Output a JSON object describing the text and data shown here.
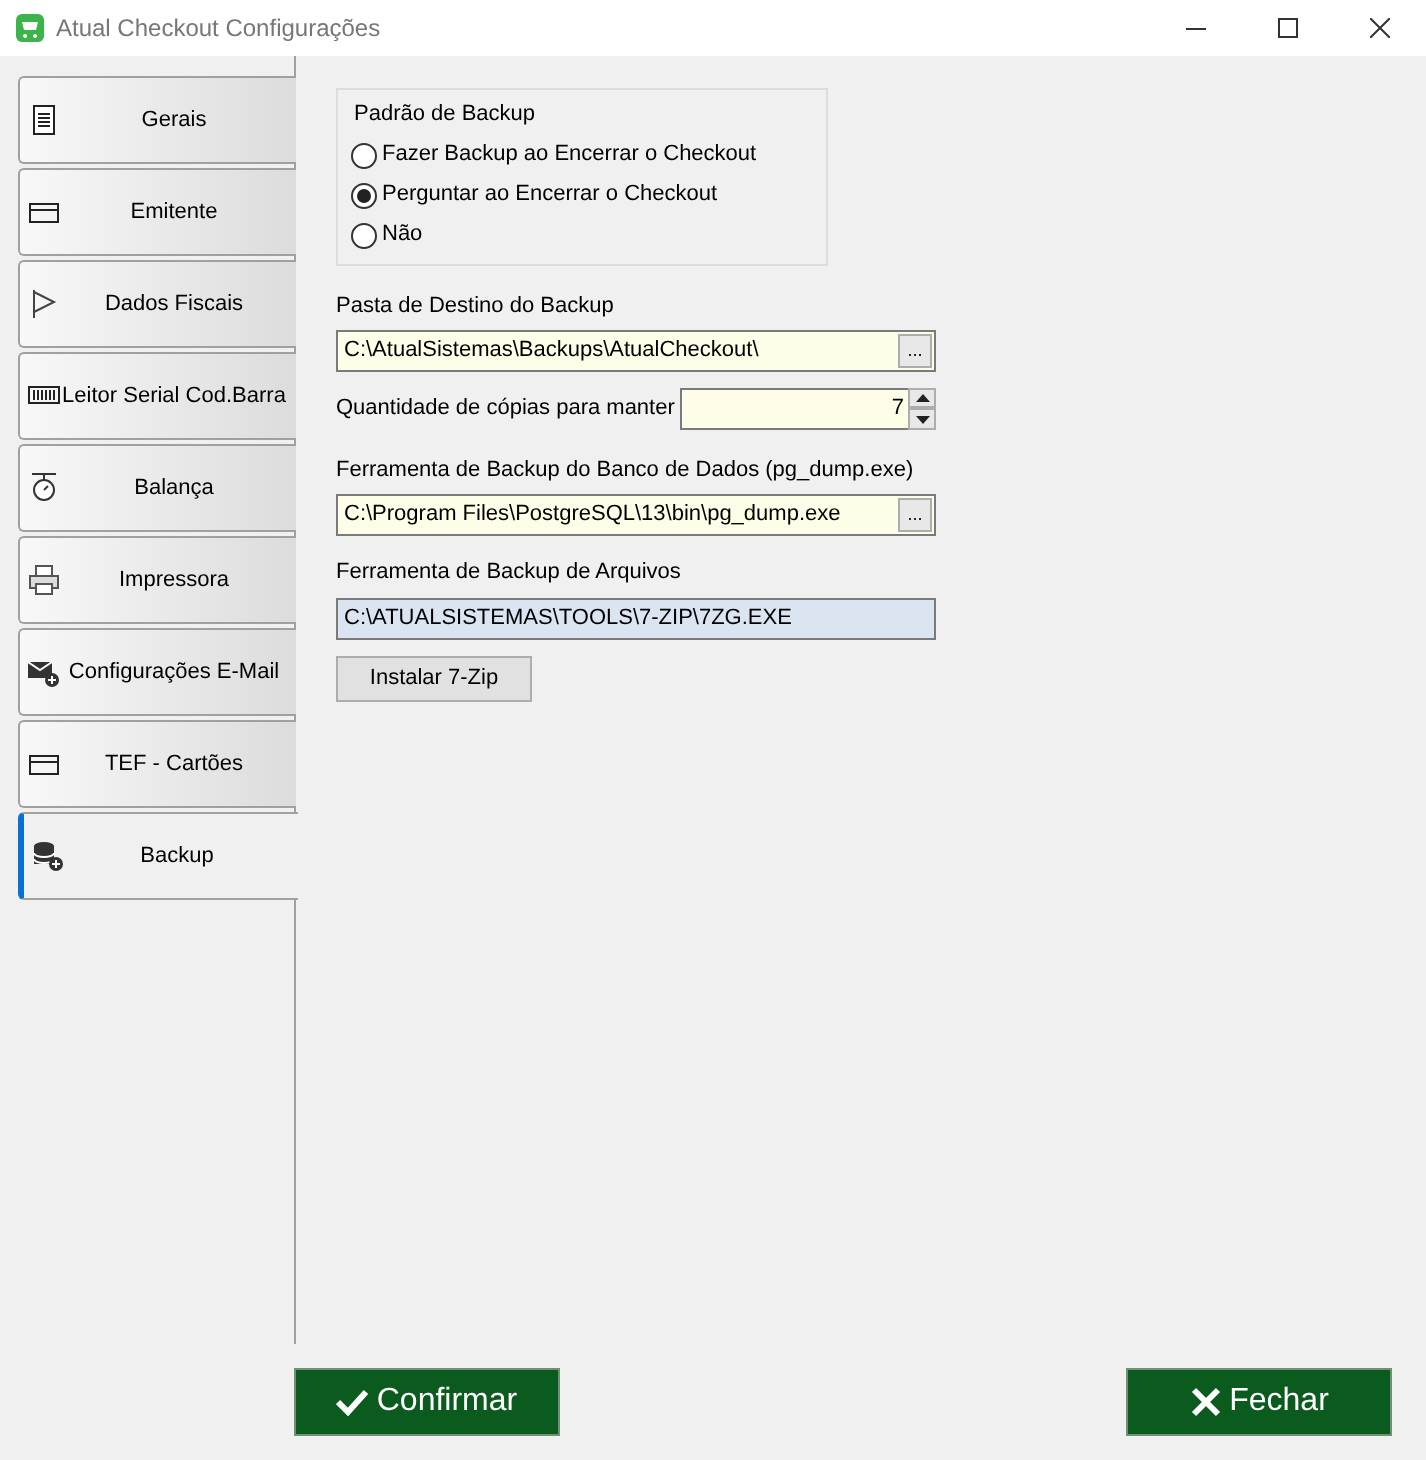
{
  "window": {
    "title": "Atual Checkout Configurações"
  },
  "tabs": [
    {
      "label": "Gerais",
      "selected": false
    },
    {
      "label": "Emitente",
      "selected": false
    },
    {
      "label": "Dados Fiscais",
      "selected": false
    },
    {
      "label": "Leitor Serial Cod.Barra",
      "selected": false
    },
    {
      "label": "Balança",
      "selected": false
    },
    {
      "label": "Impressora",
      "selected": false
    },
    {
      "label": "Configurações E-Mail",
      "selected": false
    },
    {
      "label": "TEF - Cartões",
      "selected": false
    },
    {
      "label": "Backup",
      "selected": true
    }
  ],
  "backup_mode": {
    "title": "Padrão de Backup",
    "options": [
      {
        "label": "Fazer Backup ao Encerrar o Checkout",
        "selected": false
      },
      {
        "label": "Perguntar ao Encerrar o Checkout",
        "selected": true
      },
      {
        "label": "Não",
        "selected": false
      }
    ]
  },
  "fields": [
    {
      "kind": "browse",
      "label": "Pasta de Destino do Backup",
      "value": "C:\\AtualSistemas\\Backups\\AtualCheckout\\",
      "button": "...",
      "readonly": false
    },
    {
      "kind": "spin",
      "label": "Quantidade de cópias para manter",
      "value": "7",
      "readonly": false
    },
    {
      "kind": "browse",
      "label": "Ferramenta de Backup do Banco de Dados (pg_dump.exe)",
      "value": "C:\\Program Files\\PostgreSQL\\13\\bin\\pg_dump.exe",
      "button": "...",
      "readonly": false
    },
    {
      "kind": "text",
      "label": "Ferramenta de Backup de Arquivos",
      "value": "C:\\ATUALSISTEMAS\\TOOLS\\7-ZIP\\7ZG.EXE",
      "readonly": true
    }
  ],
  "install_button": "Instalar 7-Zip",
  "footer_buttons": [
    {
      "kind": "confirm",
      "label": "Confirmar"
    },
    {
      "kind": "close",
      "label": "Fechar"
    }
  ]
}
